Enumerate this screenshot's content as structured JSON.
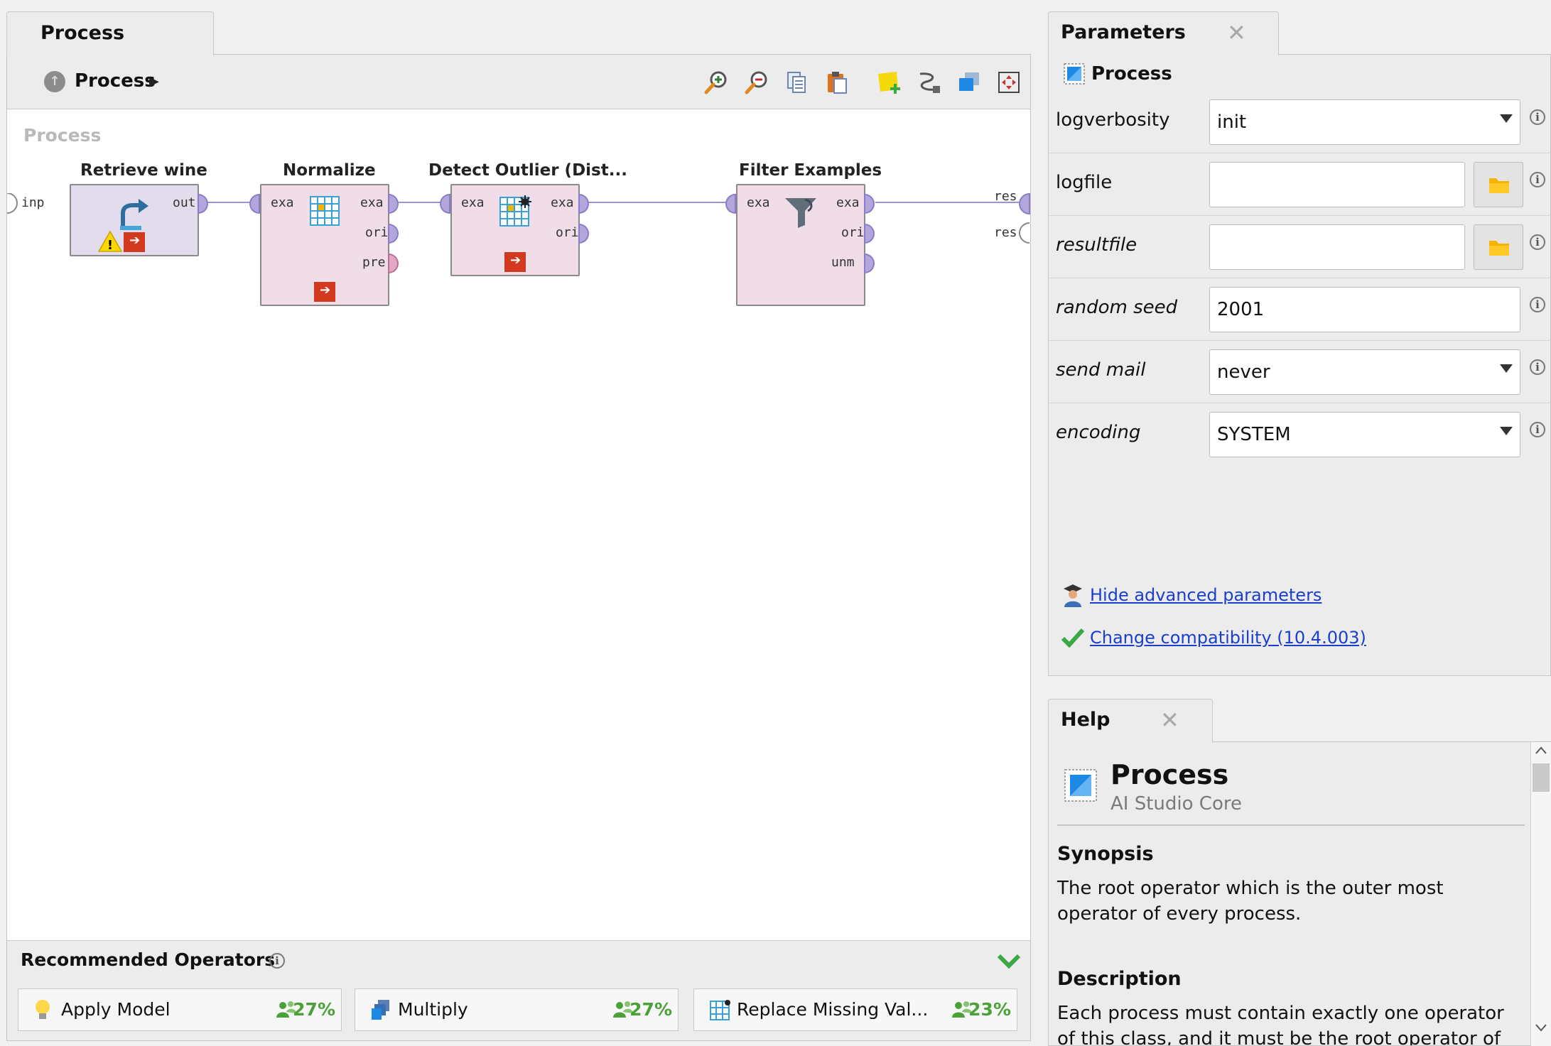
{
  "process_panel": {
    "tab_label": "Process",
    "breadcrumb": "Process",
    "canvas_label": "Process",
    "toolbar_icons": [
      "zoom-in-icon",
      "zoom-out-icon",
      "copy-icon",
      "paste-icon",
      "add-note-icon",
      "auto-wire-icon",
      "layers-icon",
      "fit-view-icon"
    ],
    "canvas_ports": {
      "input": "inp",
      "result_1": "res",
      "result_2": "res"
    },
    "operators": [
      {
        "title": "Retrieve wine",
        "in_ports": [],
        "out_ports": [
          "out"
        ],
        "warning": true
      },
      {
        "title": "Normalize",
        "in_ports": [
          "exa"
        ],
        "out_ports": [
          "exa",
          "ori",
          "pre"
        ]
      },
      {
        "title": "Detect Outlier (Dist...",
        "in_ports": [
          "exa"
        ],
        "out_ports": [
          "exa",
          "ori"
        ]
      },
      {
        "title": "Filter Examples",
        "in_ports": [
          "exa"
        ],
        "out_ports": [
          "exa",
          "ori",
          "unm"
        ]
      }
    ],
    "recommended": {
      "title": "Recommended Operators",
      "items": [
        {
          "name": "Apply Model",
          "percent": "27%",
          "icon": "lightbulb-icon"
        },
        {
          "name": "Multiply",
          "percent": "27%",
          "icon": "multiply-icon"
        },
        {
          "name": "Replace Missing Val...",
          "percent": "23%",
          "icon": "table-icon"
        }
      ]
    }
  },
  "parameters_panel": {
    "tab_label": "Parameters",
    "operator_label": "Process",
    "rows": [
      {
        "label": "logverbosity",
        "value": "init",
        "type": "dropdown"
      },
      {
        "label": "logfile",
        "value": "",
        "type": "file"
      },
      {
        "label": "resultfile",
        "value": "",
        "type": "file"
      },
      {
        "label": "random seed",
        "value": "2001",
        "type": "text"
      },
      {
        "label": "send mail",
        "value": "never",
        "type": "dropdown"
      },
      {
        "label": "encoding",
        "value": "SYSTEM",
        "type": "dropdown"
      }
    ],
    "hide_advanced_link": "Hide advanced parameters",
    "compatibility_link": "Change compatibility (10.4.003)"
  },
  "help_panel": {
    "tab_label": "Help",
    "title": "Process",
    "subtitle": "AI Studio Core",
    "synopsis_heading": "Synopsis",
    "synopsis_text": "The root operator which is the outer most operator of every process.",
    "description_heading": "Description",
    "description_text": "Each process must contain exactly one operator of this class, and it must be the root operator of the"
  },
  "colors": {
    "operator_fill": "#f1dde8",
    "retrieve_fill": "#e2dcec",
    "port_purple": "#b3a6dd",
    "link_blue": "#1a3fcf",
    "percent_green": "#4aa138"
  }
}
